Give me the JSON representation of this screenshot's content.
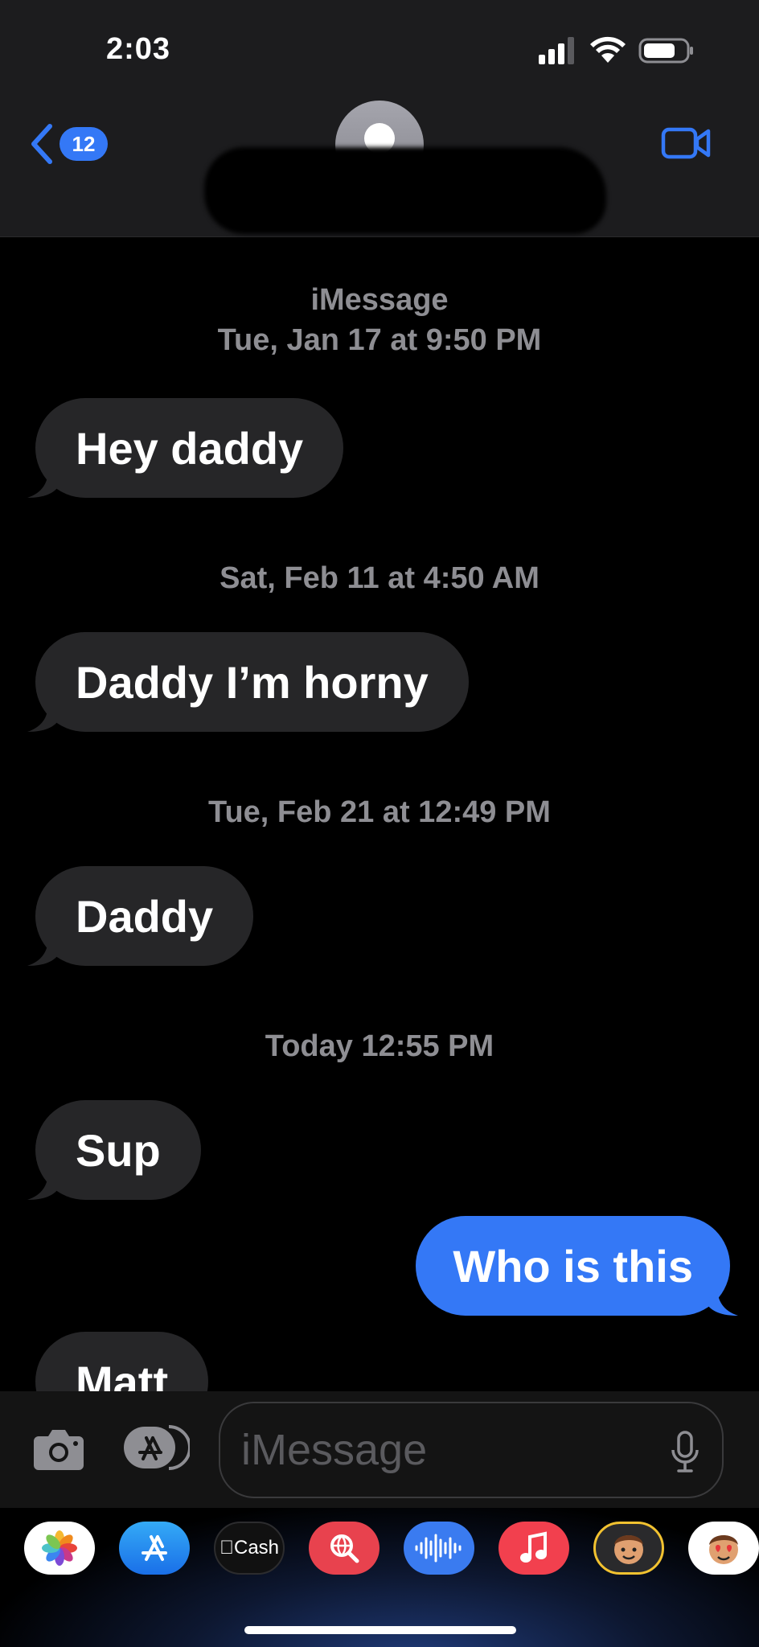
{
  "status_bar": {
    "time": "2:03"
  },
  "header": {
    "back_badge": "12"
  },
  "thread": {
    "service": "iMessage",
    "first_timestamp": "Tue, Jan 17 at 9:50 PM",
    "items": [
      {
        "timestamp": "Sat, Feb 11 at 4:50 AM"
      },
      {
        "timestamp": "Tue, Feb 21 at 12:49 PM"
      },
      {
        "timestamp": "Today 12:55 PM"
      }
    ],
    "messages": [
      {
        "text": "Hey daddy",
        "direction": "received"
      },
      {
        "text": "Daddy I’m horny",
        "direction": "received"
      },
      {
        "text": "Daddy",
        "direction": "received"
      },
      {
        "text": "Sup",
        "direction": "received"
      },
      {
        "text": "Who is this",
        "direction": "sent"
      },
      {
        "text": "Matt",
        "direction": "received"
      }
    ]
  },
  "composer": {
    "placeholder": "iMessage"
  },
  "app_drawer": {
    "apps": [
      {
        "icon": "photos-icon"
      },
      {
        "icon": "app-store-icon"
      },
      {
        "icon": "apple-cash-icon",
        "label": "Cash"
      },
      {
        "icon": "search-images-icon"
      },
      {
        "icon": "audio-message-icon"
      },
      {
        "icon": "music-icon"
      },
      {
        "icon": "memoji-icon"
      },
      {
        "icon": "animoji-stickers-icon"
      }
    ]
  },
  "colors": {
    "sent_bubble": "#3478f6",
    "received_bubble": "#262628",
    "accent": "#3478f6"
  }
}
